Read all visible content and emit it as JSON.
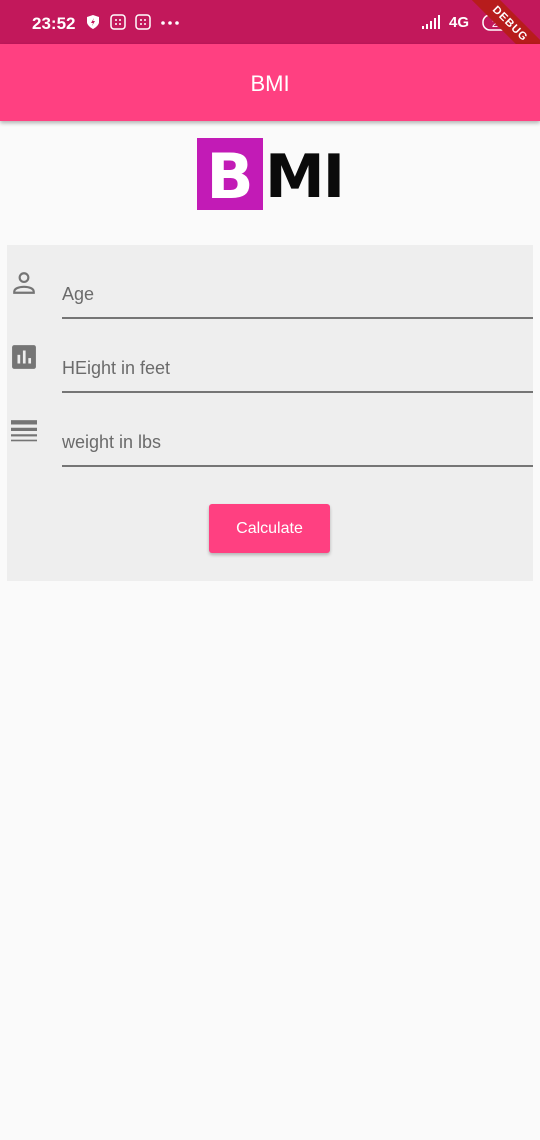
{
  "status_bar": {
    "time": "23:52",
    "network": "4G",
    "battery": "26"
  },
  "debug_banner": "DEBUG",
  "app_bar": {
    "title": "BMI"
  },
  "logo": {
    "letter_b": "B",
    "letters_mi": "MI"
  },
  "form": {
    "age_placeholder": "Age",
    "height_placeholder": "HEight in feet",
    "weight_placeholder": "weight in lbs",
    "calculate_label": "Calculate"
  },
  "colors": {
    "primary": "#ff4081",
    "status_bar": "#c2185b",
    "logo_accent": "#c21bb6"
  }
}
